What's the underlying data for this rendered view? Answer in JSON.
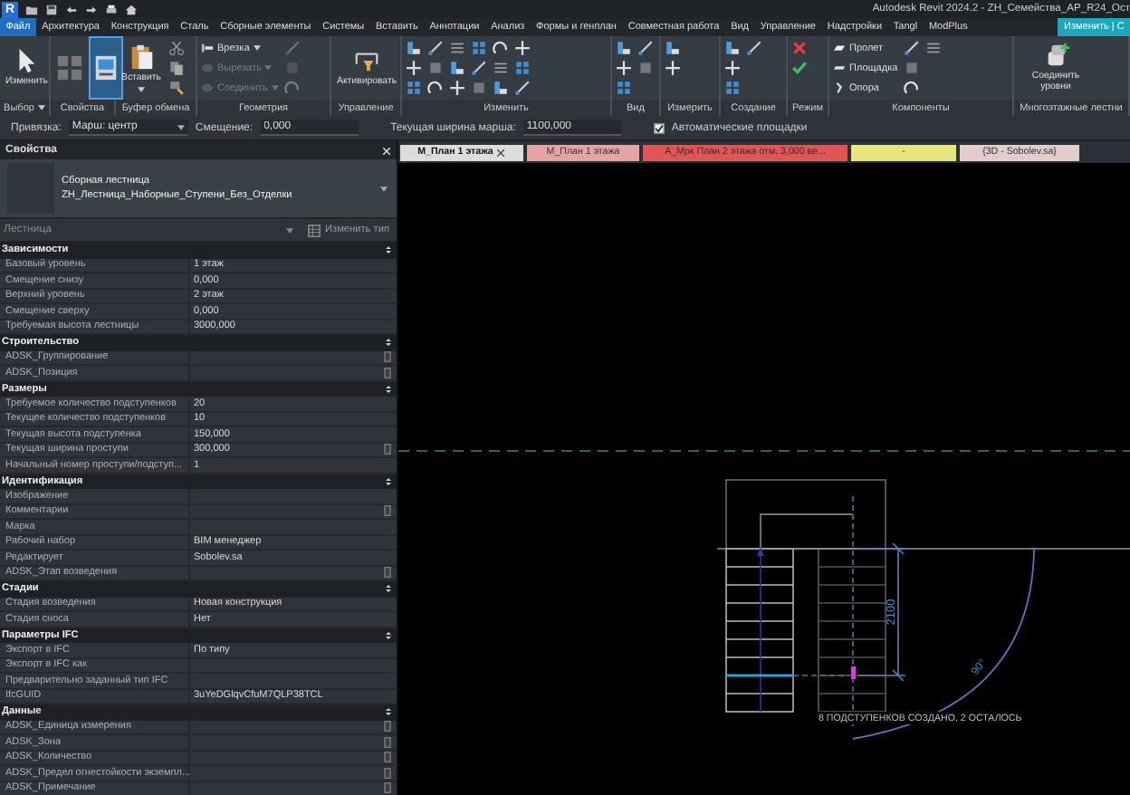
{
  "title_bar": {
    "app_badge": "R",
    "title": "Autodesk Revit 2024.2 - ZH_Семейства_АР_R24_Ост"
  },
  "ribbon_tabs": [
    {
      "label": "Файл",
      "kind": "file",
      "selected": false
    },
    {
      "label": "Архитектура",
      "kind": "tab",
      "selected": false
    },
    {
      "label": "Конструкция",
      "kind": "tab",
      "selected": false
    },
    {
      "label": "Сталь",
      "kind": "tab",
      "selected": false
    },
    {
      "label": "Сборные элементы",
      "kind": "tab",
      "selected": false
    },
    {
      "label": "Системы",
      "kind": "tab",
      "selected": false
    },
    {
      "label": "Вставить",
      "kind": "tab",
      "selected": false
    },
    {
      "label": "Аннотации",
      "kind": "tab",
      "selected": false
    },
    {
      "label": "Анализ",
      "kind": "tab",
      "selected": false
    },
    {
      "label": "Формы и генплан",
      "kind": "tab",
      "selected": false
    },
    {
      "label": "Совместная работа",
      "kind": "tab",
      "selected": false
    },
    {
      "label": "Вид",
      "kind": "tab",
      "selected": false
    },
    {
      "label": "Управление",
      "kind": "tab",
      "selected": false
    },
    {
      "label": "Надстройки",
      "kind": "tab",
      "selected": false
    },
    {
      "label": "Tangl",
      "kind": "tab",
      "selected": false
    },
    {
      "label": "ModPlus",
      "kind": "tab",
      "selected": false
    },
    {
      "label": "Изменить | С",
      "kind": "tab",
      "selected": true
    }
  ],
  "ribbon_panels": [
    {
      "label": "Выбор",
      "dropdown": true,
      "tools": [
        {
          "kind": "cursor",
          "label": "Изменить"
        }
      ]
    },
    {
      "label": "Свойства",
      "tools": [
        {
          "kind": "squares",
          "on": false
        },
        {
          "kind": "window",
          "on": true
        }
      ]
    },
    {
      "label": "Буфер обмена",
      "tools": [
        {
          "kind": "clipboard",
          "label": "Вставить",
          "dropdown": true
        },
        {
          "kind": "scissors"
        },
        {
          "kind": "copy"
        },
        {
          "kind": "brush"
        }
      ]
    },
    {
      "label": "Геометрия",
      "tools": [
        {
          "kind": "beam",
          "label": "Врезка",
          "dropdown": true,
          "disabled": false
        },
        {
          "kind": "shape",
          "label": "Вырезать",
          "dropdown": true,
          "disabled": true
        },
        {
          "kind": "shape",
          "label": "Соединить",
          "dropdown": true,
          "disabled": true
        },
        {
          "kind": "icon",
          "disabled": true
        },
        {
          "kind": "icon",
          "disabled": true
        },
        {
          "kind": "icon",
          "disabled": true
        }
      ]
    },
    {
      "label": "Управление",
      "tools": [
        {
          "kind": "pin",
          "label": "Активировать"
        }
      ]
    },
    {
      "label": "Изменить",
      "tools": [
        {
          "kind": "icon"
        },
        {
          "kind": "icon"
        },
        {
          "kind": "icon"
        },
        {
          "kind": "icon"
        },
        {
          "kind": "icon"
        },
        {
          "kind": "icon"
        },
        {
          "kind": "icon"
        },
        {
          "kind": "icon"
        },
        {
          "kind": "icon"
        },
        {
          "kind": "icon"
        },
        {
          "kind": "icon"
        },
        {
          "kind": "icon"
        },
        {
          "kind": "icon"
        },
        {
          "kind": "icon"
        },
        {
          "kind": "icon"
        },
        {
          "kind": "icon"
        },
        {
          "kind": "icon"
        },
        {
          "kind": "icon"
        }
      ]
    },
    {
      "label": "Вид",
      "tools": [
        {
          "kind": "icon"
        },
        {
          "kind": "icon"
        },
        {
          "kind": "icon"
        },
        {
          "kind": "icon"
        },
        {
          "kind": "icon"
        }
      ]
    },
    {
      "label": "Измерить",
      "tools": [
        {
          "kind": "icon"
        },
        {
          "kind": "icon"
        }
      ]
    },
    {
      "label": "Создание",
      "tools": [
        {
          "kind": "icon"
        },
        {
          "kind": "icon"
        },
        {
          "kind": "icon"
        },
        {
          "kind": "icon"
        }
      ]
    },
    {
      "label": "Режим",
      "tools": [
        {
          "kind": "cancel"
        },
        {
          "kind": "check"
        }
      ]
    },
    {
      "label": "Компоненты",
      "tools": [
        {
          "kind": "slab",
          "label": "Пролет"
        },
        {
          "kind": "landing",
          "label": "Площадка"
        },
        {
          "kind": "support",
          "label": "Опора"
        },
        {
          "kind": "icon"
        },
        {
          "kind": "icon"
        },
        {
          "kind": "icon"
        },
        {
          "kind": "icon"
        }
      ]
    },
    {
      "label": "Многоэтажные лестни",
      "tools": [
        {
          "kind": "stack",
          "label": "Соединить уровни"
        }
      ]
    }
  ],
  "options_bar": {
    "snap_label": "Привязка:",
    "snap_value": "Марш: центр",
    "offset_label": "Смещение:",
    "offset_value": "0,000",
    "width_label": "Текущая ширина марша:",
    "width_value": "1100,000",
    "auto_landings": {
      "label": "Автоматические площадки",
      "checked": true
    }
  },
  "properties": {
    "title": "Свойства",
    "type_family": "Сборная лестница",
    "type_name": "ZH_Лестница_Наборные_Ступени_Без_Отделки",
    "filter": "Лестница",
    "edit_type": "Изменить тип",
    "groups": [
      {
        "title": "Зависимости",
        "rows": [
          {
            "name": "Базовый уровень",
            "value": "1 этаж",
            "kind": "plain"
          },
          {
            "name": "Смещение снизу",
            "value": "0,000",
            "kind": "plain"
          },
          {
            "name": "Верхний уровень",
            "value": "2 этаж",
            "kind": "plain"
          },
          {
            "name": "Смещение сверху",
            "value": "0,000",
            "kind": "plain"
          },
          {
            "name": "Требуемая высота лестницы",
            "value": "3000,000",
            "kind": "plain"
          }
        ]
      },
      {
        "title": "Строительство",
        "rows": [
          {
            "name": "ADSK_Группирование",
            "kind": "linked"
          },
          {
            "name": "ADSK_Позиция",
            "kind": "linked"
          }
        ]
      },
      {
        "title": "Размеры",
        "rows": [
          {
            "name": "Требуемое количество подступенков",
            "value": "20",
            "kind": "plain"
          },
          {
            "name": "Текущее количество подступенков",
            "value": "10",
            "kind": "plain"
          },
          {
            "name": "Текущая высота подступенка",
            "value": "150,000",
            "kind": "plain"
          },
          {
            "name": "Текущая ширина проступи",
            "value": "300,000",
            "kind": "linked"
          },
          {
            "name": "Начальный номер проступи/подступ...",
            "value": "1",
            "kind": "plain"
          }
        ]
      },
      {
        "title": "Идентификация",
        "rows": [
          {
            "name": "Изображение",
            "kind": "plain"
          },
          {
            "name": "Комментарии",
            "kind": "linked"
          },
          {
            "name": "Марка",
            "kind": "plain"
          },
          {
            "name": "Рабочий набор",
            "value": "BIM менеджер",
            "kind": "plain"
          },
          {
            "name": "Редактирует",
            "value": "Sobolev.sa",
            "kind": "plain"
          },
          {
            "name": "ADSK_Этап возведения",
            "kind": "linked"
          }
        ]
      },
      {
        "title": "Стадии",
        "rows": [
          {
            "name": "Стадия возведения",
            "value": "Новая конструкция",
            "kind": "plain"
          },
          {
            "name": "Стадия сноса",
            "value": "Нет",
            "kind": "plain"
          }
        ]
      },
      {
        "title": "Параметры IFC",
        "rows": [
          {
            "name": "Экспорт в IFC",
            "value": "По типу",
            "kind": "plain"
          },
          {
            "name": "Экспорт в IFC как",
            "kind": "plain"
          },
          {
            "name": "Предварительно заданный тип IFC",
            "kind": "plain"
          },
          {
            "name": "IfcGUID",
            "value": "3uYeDGlqvCfuM7QLP38TCL",
            "kind": "plain"
          }
        ]
      },
      {
        "title": "Данные",
        "rows": [
          {
            "name": "ADSK_Единица измерения",
            "kind": "linked"
          },
          {
            "name": "ADSK_Зона",
            "kind": "linked"
          },
          {
            "name": "ADSK_Количество",
            "kind": "linked"
          },
          {
            "name": "ADSK_Предел огнестойкости экземпл...",
            "kind": "linked"
          },
          {
            "name": "ADSK_Примечание",
            "kind": "linked"
          }
        ]
      }
    ]
  },
  "view_tabs": [
    {
      "label": "M_План 1 этажа",
      "selected": true,
      "color": "#dcdcdc"
    },
    {
      "label": "M_План 1 этажа",
      "selected": false,
      "color": "#e6a3a3"
    },
    {
      "label": "А_Мрк План 2 этажа отм. 3,000 ве...",
      "selected": false,
      "color": "#e35454"
    },
    {
      "label": "-",
      "selected": false,
      "color": "#e6e67a"
    },
    {
      "label": "{3D - Sobolev.sa}",
      "selected": false,
      "color": "#e3cccc"
    }
  ],
  "canvas": {
    "dimension": "2100",
    "angle": "90°",
    "status": "8 ПОДСТУПЕНКОВ СОЗДАНО, 2 ОСТАЛОСЬ"
  }
}
